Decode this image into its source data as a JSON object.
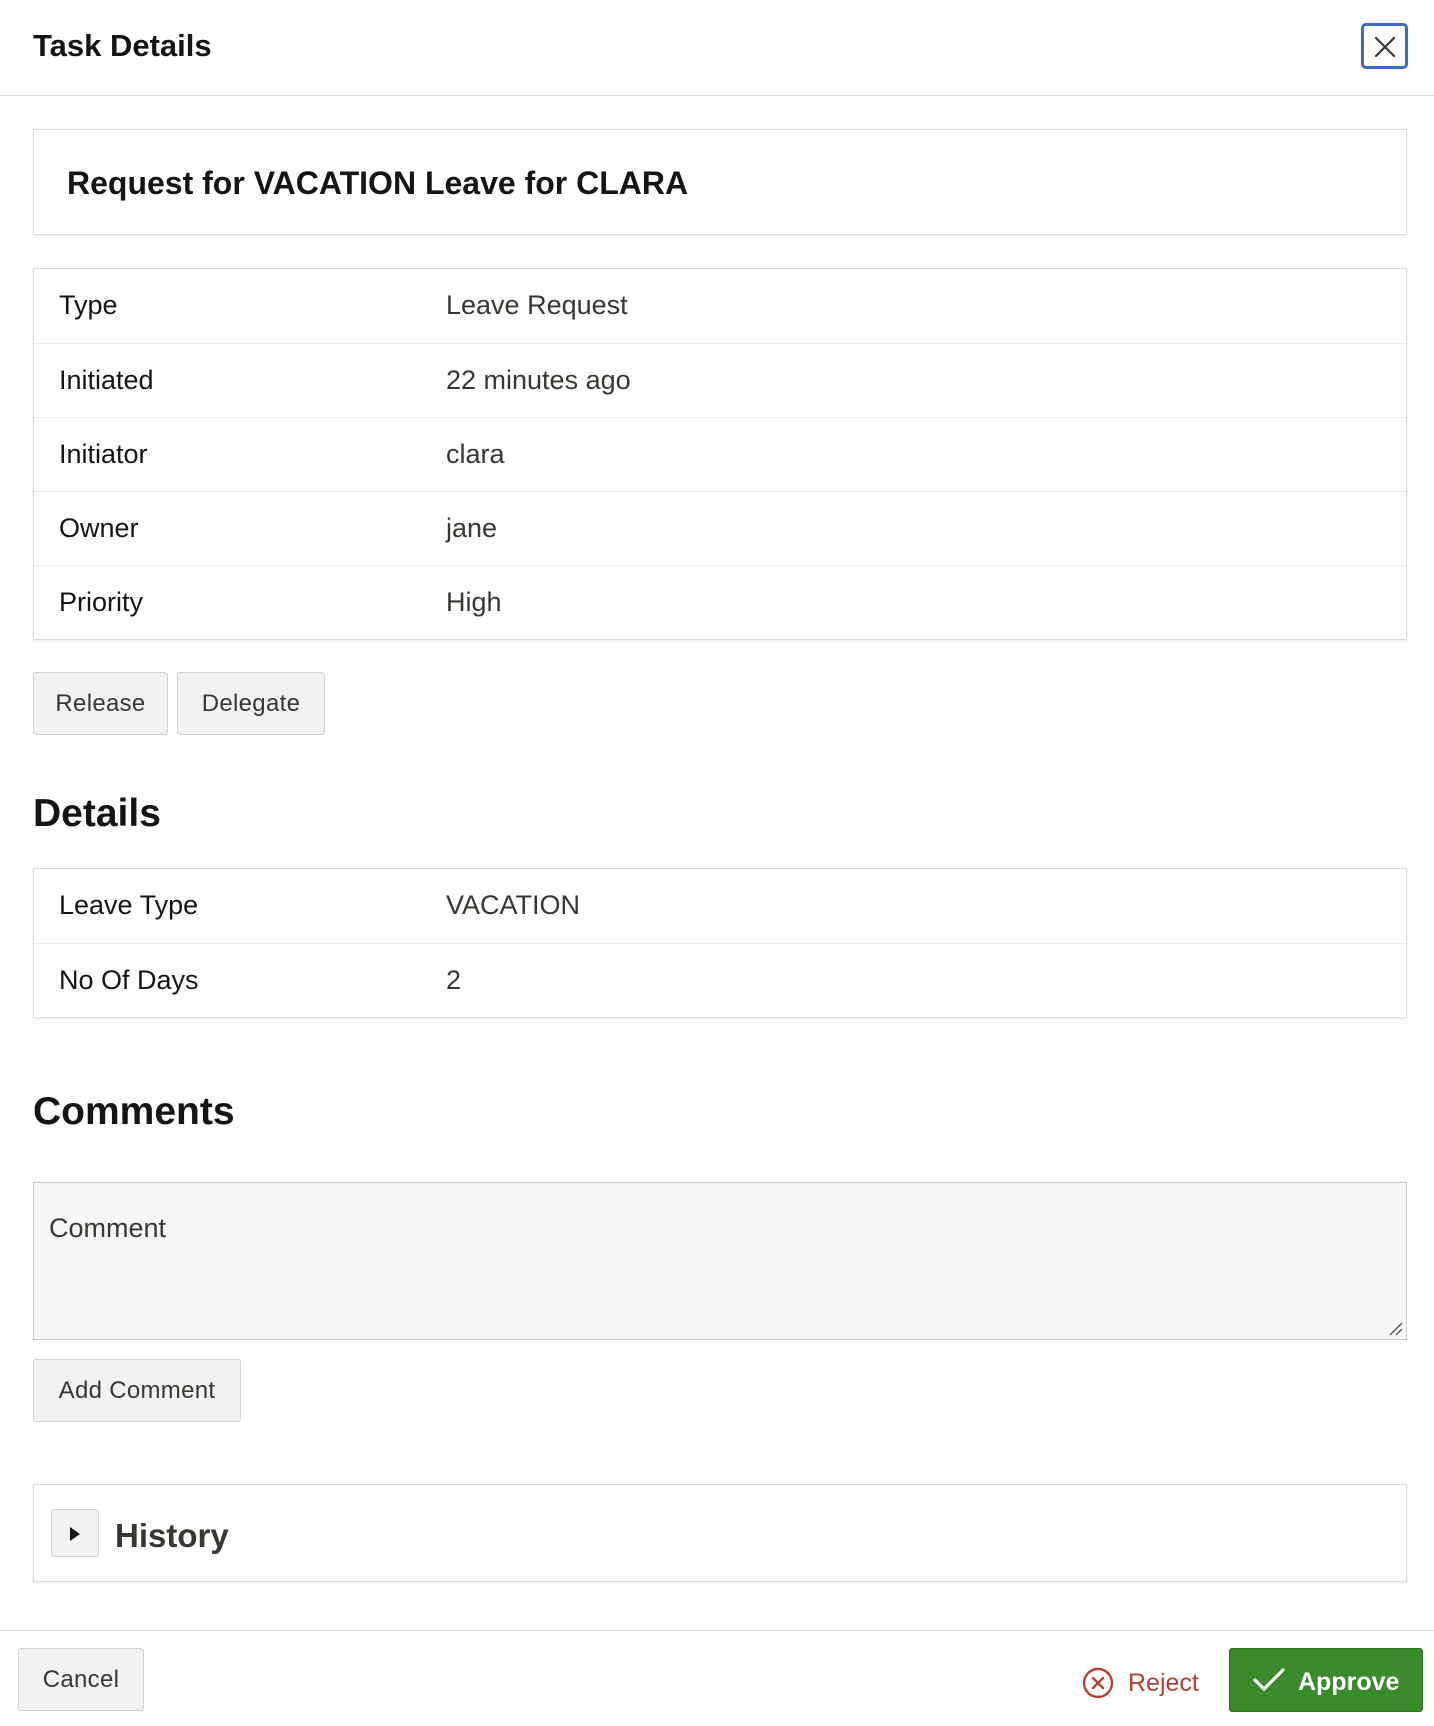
{
  "dialog": {
    "title": "Task Details",
    "close_icon": "close-icon"
  },
  "task": {
    "title": "Request for VACATION Leave for CLARA",
    "info_rows": [
      {
        "label": "Type",
        "value": "Leave Request"
      },
      {
        "label": "Initiated",
        "value": "22 minutes ago"
      },
      {
        "label": "Initiator",
        "value": "clara"
      },
      {
        "label": "Owner",
        "value": "jane"
      },
      {
        "label": "Priority",
        "value": "High"
      }
    ],
    "actions": {
      "release_label": "Release",
      "delegate_label": "Delegate"
    }
  },
  "details": {
    "heading": "Details",
    "rows": [
      {
        "label": "Leave Type",
        "value": "VACATION"
      },
      {
        "label": "No Of Days",
        "value": "2"
      }
    ]
  },
  "comments": {
    "heading": "Comments",
    "placeholder": "Comment",
    "value": "",
    "add_label": "Add Comment"
  },
  "history": {
    "label": "History",
    "expanded": false,
    "toggle_icon": "caret-right-icon"
  },
  "footer": {
    "cancel_label": "Cancel",
    "reject_label": "Reject",
    "reject_icon": "x-circle-icon",
    "approve_label": "Approve",
    "approve_icon": "checkmark-icon"
  },
  "colors": {
    "focus_ring": "#3b6bc5",
    "approve": "#3b8a2b",
    "reject": "#b44132"
  }
}
